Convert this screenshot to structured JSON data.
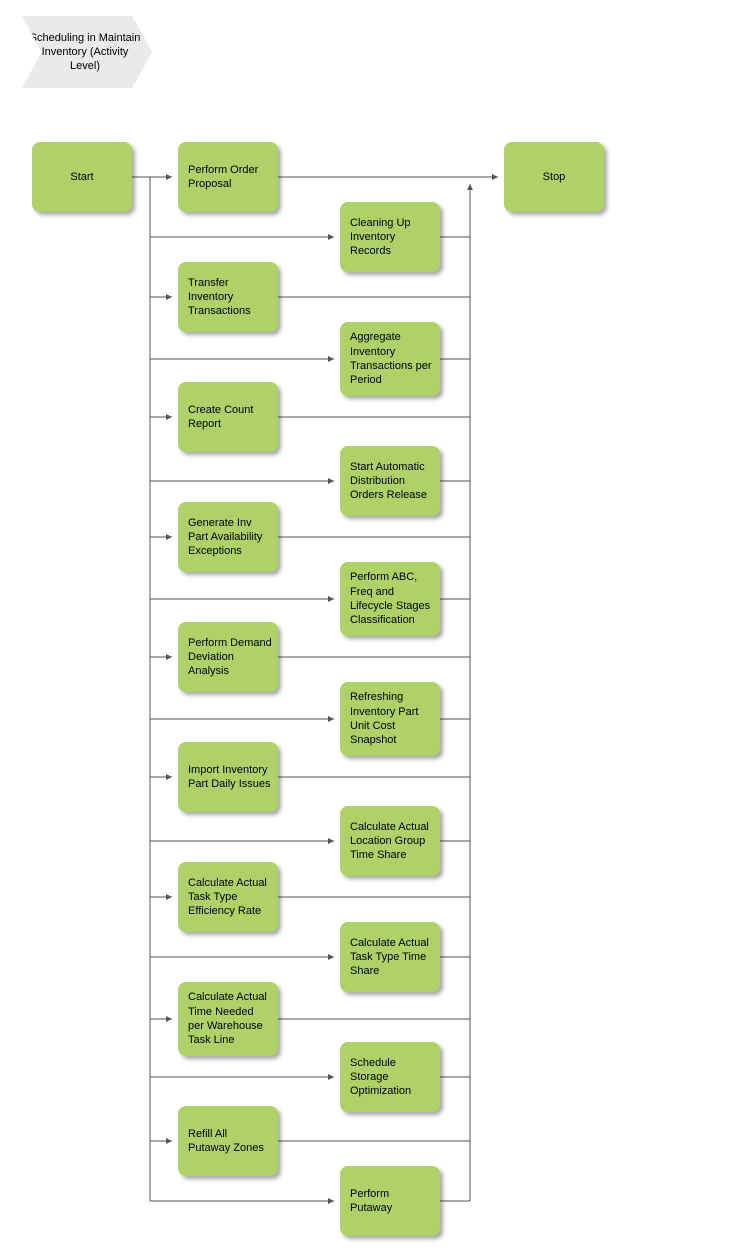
{
  "banner": {
    "label": "Scheduling in Maintain Inventory (Activity Level)"
  },
  "nodes": {
    "start": "Start",
    "stop": "Stop",
    "performOrderProposal": "Perform Order Proposal",
    "cleaningUp": "Cleaning Up Inventory Records",
    "transferInv": "Transfer Inventory Transactions",
    "aggregate": "Aggregate Inventory Transactions per Period",
    "createCount": "Create Count Report",
    "startAuto": "Start Automatic Distribution Orders Release",
    "generateInv": "Generate Inv Part Availability Exceptions",
    "performAbc": "Perform ABC, Freq and Lifecycle Stages Classification",
    "performDemand": "Perform Demand Deviation Analysis",
    "refreshing": "Refreshing Inventory Part Unit Cost Snapshot",
    "importInv": "Import Inventory Part Daily Issues",
    "calcLocGroup": "Calculate Actual Location Group Time Share",
    "calcEff": "Calculate Actual Task Type Efficiency Rate",
    "calcTaskTime": "Calculate Actual Task Type Time Share",
    "calcTimeNeeded": "Calculate Actual Time Needed per Warehouse Task Line",
    "scheduleStorage": "Schedule Storage Optimization",
    "refillAll": "Refill All Putaway Zones",
    "performPutaway": "Perform Putaway"
  }
}
